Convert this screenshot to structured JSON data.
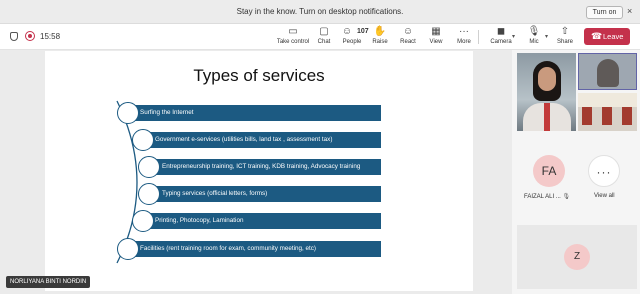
{
  "notification": {
    "text": "Stay in the know. Turn on desktop notifications.",
    "turn_on_label": "Turn on",
    "close_icon": "×"
  },
  "toolbar": {
    "timer": "15:58",
    "take_control": "Take control",
    "chat": "Chat",
    "people": "People",
    "people_count": "107",
    "raise": "Raise",
    "react": "React",
    "view": "View",
    "more": "More",
    "camera": "Camera",
    "mic": "Mic",
    "share": "Share",
    "leave": "Leave",
    "icons": {
      "take_control": "▭",
      "chat": "▢",
      "people": "☺",
      "raise": "✋",
      "react": "☺",
      "view": "▦",
      "more": "···",
      "camera": "◼",
      "mic": "🎙",
      "share": "⇧",
      "leave": "☎"
    }
  },
  "slide": {
    "title": "Types of services",
    "items": [
      "Surfing the Internet",
      "Government e-services (utilities bills, land tax , assessment tax)",
      "Entrepreneurship training, ICT training, KDB training, Advocacy training",
      "Typing services (official letters, forms)",
      "Printing, Photocopy, Lamination",
      "Facilities (rent training room for exam, community meeting, etc)"
    ],
    "colors": {
      "bar": "#1c5a82"
    }
  },
  "presenter_name": "NORLIYANA BINTI NORDIN",
  "participants": {
    "fa_initials": "FA",
    "fa_name": "FAIZAL ALI ...",
    "view_all_icon": "···",
    "view_all_label": "View all",
    "z_initials": "Z"
  },
  "colors": {
    "leave": "#c4314b",
    "accent": "#6264a7"
  }
}
